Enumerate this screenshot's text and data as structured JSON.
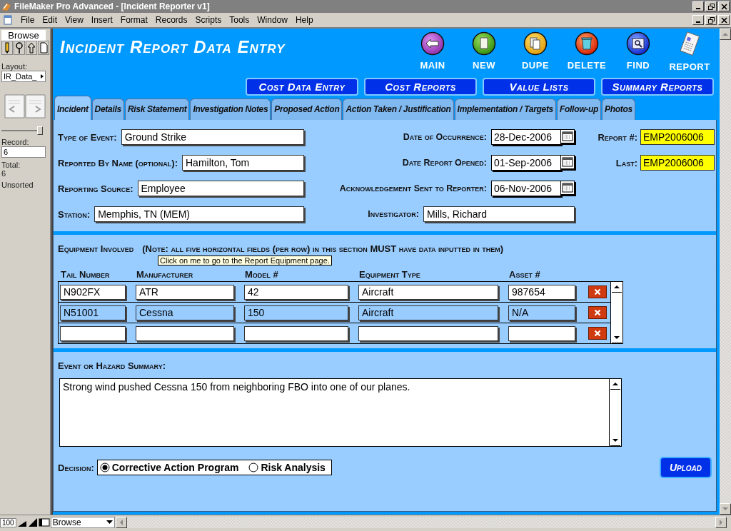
{
  "window": {
    "title": "FileMaker Pro Advanced - [Incident Reporter v1]"
  },
  "menu": [
    "File",
    "Edit",
    "View",
    "Insert",
    "Format",
    "Records",
    "Scripts",
    "Tools",
    "Window",
    "Help"
  ],
  "status_area": {
    "mode": "Browse",
    "layout_label": "Layout:",
    "layout": "IR_Data_",
    "record_slider": {
      "level": 1
    },
    "record_label": "Record:",
    "record": "6",
    "total_label": "Total:",
    "total": "6",
    "sort_state": "Unsorted"
  },
  "header": {
    "title": "Incident Report Data Entry",
    "actions": [
      {
        "label": "MAIN",
        "kind": "main"
      },
      {
        "label": "NEW",
        "kind": "new"
      },
      {
        "label": "DUPE",
        "kind": "dupe"
      },
      {
        "label": "DELETE",
        "kind": "delete"
      },
      {
        "label": "FIND",
        "kind": "find"
      },
      {
        "label": "REPORT",
        "kind": "report"
      }
    ],
    "nav_buttons": [
      "Cost Data Entry",
      "Cost Reports",
      "Value Lists",
      "Summary Reports"
    ]
  },
  "tabs": [
    {
      "label": "Incident",
      "selected": true
    },
    {
      "label": "Details",
      "selected": false
    },
    {
      "label": "Risk Statement",
      "selected": false
    },
    {
      "label": "Investigation Notes",
      "selected": false
    },
    {
      "label": "Proposed Action",
      "selected": false
    },
    {
      "label": "Action Taken / Justification",
      "selected": false
    },
    {
      "label": "Implementation / Targets",
      "selected": false
    },
    {
      "label": "Follow-up",
      "selected": false
    },
    {
      "label": "Photos",
      "selected": false
    }
  ],
  "left_fields": [
    {
      "label": "Type of Event:",
      "value": "Ground Strike"
    },
    {
      "label": "Reported By Name (optional):",
      "value": "Hamilton, Tom"
    },
    {
      "label": "Reporting Source:",
      "value": "Employee"
    },
    {
      "label": "Station:",
      "value": "Memphis, TN (MEM)"
    }
  ],
  "right_fields": [
    {
      "label": "Date of Occurrence:",
      "value": "28-Dec-2006",
      "kind": "date"
    },
    {
      "label": "Date Report Opened:",
      "value": "01-Sep-2006",
      "kind": "date"
    },
    {
      "label": "Acknowledgement Sent to Reporter:",
      "value": "06-Nov-2006",
      "kind": "date"
    },
    {
      "label": "Investigator:",
      "value": "Mills, Richard",
      "kind": "text"
    }
  ],
  "report_ids": [
    {
      "label": "Report #:",
      "value": "EMP2006006"
    },
    {
      "label": "Last:",
      "value": "EMP2006006"
    }
  ],
  "equipment": {
    "label": "Equipment Involved",
    "note": "(Note: all five horizontal fields (per row) in this section **MUST** have data inputted in them)",
    "tooltip": "Click on me to go to the Report Equipment page.",
    "columns": [
      "Tail Number",
      "Manufacturer",
      "Model #",
      "Equipment Type",
      "Asset #"
    ],
    "rows": [
      {
        "cells": [
          "N902FX",
          "ATR",
          "42",
          "Aircraft",
          "987654"
        ],
        "selected": false
      },
      {
        "cells": [
          "N51001",
          "Cessna",
          "150",
          "Aircraft",
          "N/A"
        ],
        "selected": true
      },
      {
        "cells": [
          "",
          "",
          "",
          "",
          ""
        ],
        "selected": false
      }
    ]
  },
  "summary": {
    "label": "Event or Hazard Summary:",
    "value": "Strong wind pushed Cessna 150 from neighboring FBO into one of our planes."
  },
  "decision": {
    "label": "Decision:",
    "options": [
      {
        "label": "Corrective Action Program",
        "selected": true
      },
      {
        "label": "Risk Analysis",
        "selected": false
      }
    ]
  },
  "upload_button": "Upload",
  "bottom_bar": {
    "zoom": "100",
    "mode": "Browse"
  }
}
